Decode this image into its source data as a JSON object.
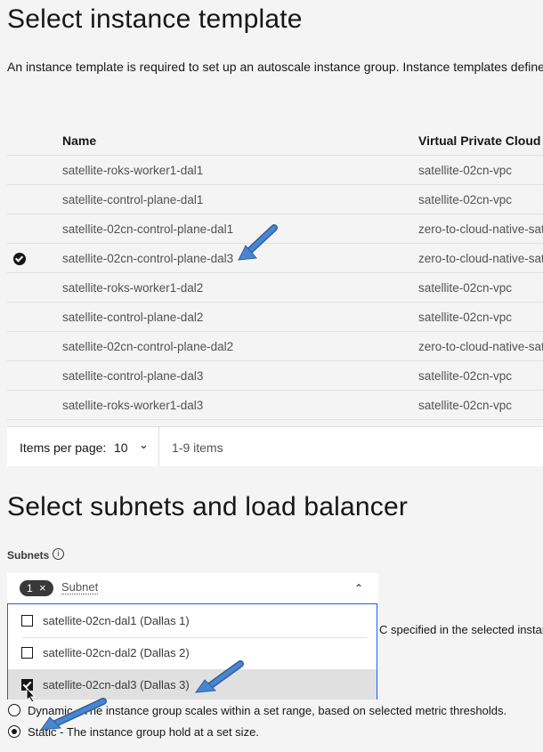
{
  "template_section": {
    "title": "Select instance template",
    "description": "An instance template is required to set up an autoscale instance group. Instance templates define the so",
    "columns": [
      "Name",
      "Virtual Private Cloud"
    ],
    "rows": [
      {
        "name": "satellite-roks-worker1-dal1",
        "vpc": "satellite-02cn-vpc",
        "selected": false
      },
      {
        "name": "satellite-control-plane-dal1",
        "vpc": "satellite-02cn-vpc",
        "selected": false
      },
      {
        "name": "satellite-02cn-control-plane-dal1",
        "vpc": "zero-to-cloud-native-sat",
        "selected": false
      },
      {
        "name": "satellite-02cn-control-plane-dal3",
        "vpc": "zero-to-cloud-native-sat",
        "selected": true
      },
      {
        "name": "satellite-roks-worker1-dal2",
        "vpc": "satellite-02cn-vpc",
        "selected": false
      },
      {
        "name": "satellite-control-plane-dal2",
        "vpc": "satellite-02cn-vpc",
        "selected": false
      },
      {
        "name": "satellite-02cn-control-plane-dal2",
        "vpc": "zero-to-cloud-native-sat",
        "selected": false
      },
      {
        "name": "satellite-control-plane-dal3",
        "vpc": "satellite-02cn-vpc",
        "selected": false
      },
      {
        "name": "satellite-roks-worker1-dal3",
        "vpc": "satellite-02cn-vpc",
        "selected": false
      }
    ],
    "pagination": {
      "items_per_page_label": "Items per page:",
      "items_per_page": "10",
      "range": "1-9 items"
    }
  },
  "subnet_section": {
    "title": "Select subnets and load balancer",
    "subnets_label": "Subnets",
    "tag_count": "1",
    "placeholder": "Subnet",
    "options": [
      {
        "label": "satellite-02cn-dal1 (Dallas 1)",
        "checked": false
      },
      {
        "label": "satellite-02cn-dal2 (Dallas 2)",
        "checked": false
      },
      {
        "label": "satellite-02cn-dal3 (Dallas 3)",
        "checked": true
      }
    ],
    "hidden_text": "C specified in the selected instan",
    "membership": [
      {
        "label": "Dynamic - The instance group scales within a set range, based on selected metric thresholds.",
        "selected": false
      },
      {
        "label": "Static - The instance group hold at a set size.",
        "selected": true
      }
    ]
  },
  "colors": {
    "background": "#f4f4f4",
    "focus": "#0f62fe",
    "arrow": "#4a86cf"
  }
}
